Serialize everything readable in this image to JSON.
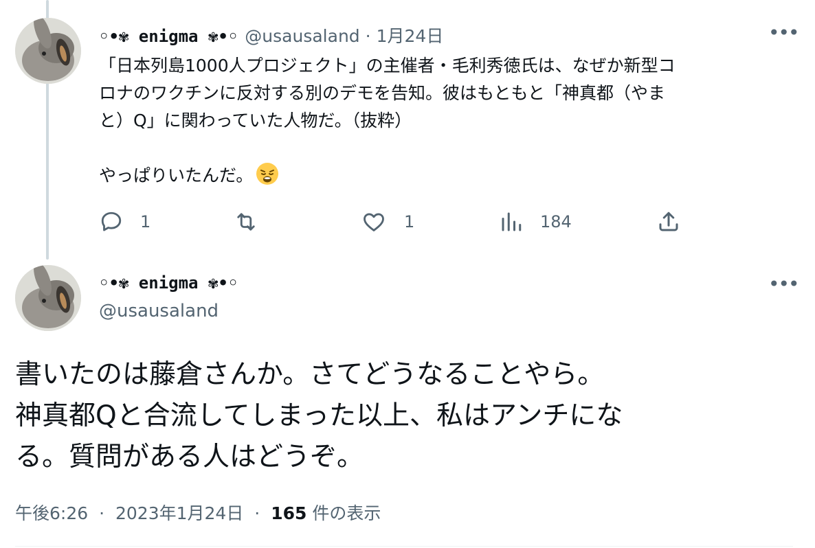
{
  "quoted_tweet": {
    "author": {
      "display_name": "◦•✾ enigma ✾•◦",
      "handle": "@usausaland"
    },
    "date": "1月24日",
    "text": "「日本列島1000人プロジェクト」の主催者・毛利秀徳氏は、なぜか新型コ\nロナのワクチンに反対する別のデモを告知。彼はもともと「神真都（やま\nと）Q」に関わっていた人物だ。（抜粋）\n\nやっぱりいたんだ。",
    "emoji": "weary-face",
    "actions": {
      "reply_count": "1",
      "retweet_count": "",
      "like_count": "1",
      "view_count": "184"
    }
  },
  "main_tweet": {
    "author": {
      "display_name": "◦•✾ enigma ✾•◦",
      "handle": "@usausaland"
    },
    "text": "書いたのは藤倉さんか。さてどうなることやら。\n神真都Qと合流してしまった以上、私はアンチにな\nる。質問がある人はどうぞ。",
    "time": "午後6:26",
    "date": "2023年1月24日",
    "views_number": "165",
    "views_label": "件の表示"
  },
  "ui": {
    "separator": "·",
    "more_glyph": "•••",
    "emoji_color": "#ffcc4d"
  }
}
